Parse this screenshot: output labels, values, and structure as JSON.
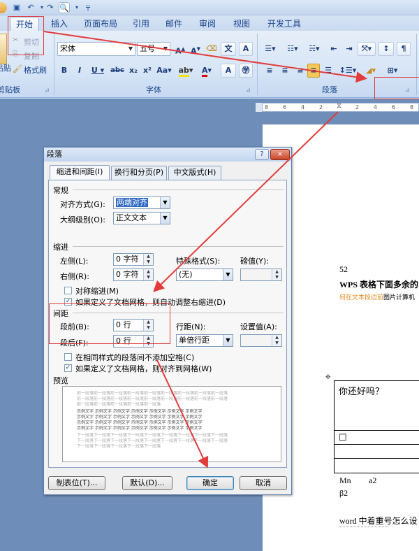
{
  "tabs": [
    "开始",
    "插入",
    "页面布局",
    "引用",
    "邮件",
    "审阅",
    "视图",
    "开发工具"
  ],
  "clipboard": {
    "cut": "剪切",
    "copy": "复制",
    "format_painter": "格式刷",
    "paste": "粘贴",
    "group": "剪贴板"
  },
  "font": {
    "name": "宋体",
    "size": "五号",
    "group": "字体"
  },
  "paragraph_group": "段落",
  "ruler_ticks": [
    "8",
    "6",
    "4",
    "2",
    "2",
    "4",
    "6",
    "8"
  ],
  "dialog": {
    "title": "段落",
    "help": "?",
    "close": "×",
    "tabs": [
      "缩进和间距(I)",
      "换行和分页(P)",
      "中文版式(H)"
    ],
    "general": {
      "section": "常规",
      "align_label": "对齐方式(G):",
      "align_value": "两端对齐",
      "outline_label": "大纲级别(O):",
      "outline_value": "正文文本"
    },
    "indent": {
      "section": "缩进",
      "left_label": "左侧(L):",
      "left_value": "0 字符",
      "right_label": "右侧(R):",
      "right_value": "0 字符",
      "special_label": "特殊格式(S):",
      "special_value": "(无)",
      "by_label": "磅值(Y):",
      "by_value": "",
      "mirror": "对称缩进(M)",
      "auto_grid": "如果定义了文档网格，则自动调整右缩进(D)"
    },
    "spacing": {
      "section": "间距",
      "before_label": "段前(B):",
      "before_value": "0 行",
      "after_label": "段后(F):",
      "after_value": "0 行",
      "line_label": "行距(N):",
      "line_value": "单倍行距",
      "at_label": "设置值(A):",
      "at_value": "",
      "no_space": "在相同样式的段落间不添加空格(C)",
      "snap_grid": "如果定义了文档网格，则对齐到网格(W)"
    },
    "preview": {
      "section": "预览",
      "prev_text": "前一段落前一段落前一段落前一段落前一段落前一段落前一段落前一段落前一段落",
      "sample_text": "示例文字 示例文字 示例文字 示例文字 示例文字 示例文字 示例文字",
      "next_text": "下一段落下一段落下一段落下一段落下一段落下一段落下一段落下一段落下一段落"
    },
    "buttons": {
      "tabs": "制表位(T)...",
      "default": "默认(D)...",
      "ok": "确定",
      "cancel": "取消"
    }
  },
  "document": {
    "num": "52",
    "heading": "WPS 表格下面多余的",
    "sub_orange": "何在文本段边前",
    "sub_black": "图片计算机",
    "table_q": "你还好吗？",
    "checkbox": "☐",
    "mn": "Mn",
    "a2": "a2",
    "b2": "β2",
    "word_line": "word 中着重号怎么设"
  },
  "colors": {
    "ribbon": "#d7e5f6",
    "accent": "#15428b",
    "annotation": "#e23b3b",
    "selected": "#316ac5"
  }
}
